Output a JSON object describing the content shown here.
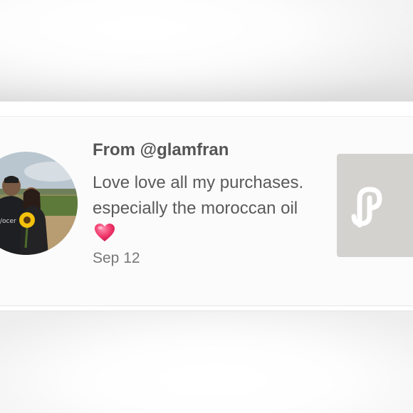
{
  "notification": {
    "sender": "From @glamfran",
    "message": "Love love all my purchases. especially the moroccan oil",
    "emoji_icon": "heart-icon",
    "date": "Sep 12",
    "thumbnail_icon": "poshmark-logo-icon"
  },
  "colors": {
    "heart": "#f0386b",
    "thumbnail_bg": "#d4d2cf",
    "text": "#5a5a5a"
  }
}
